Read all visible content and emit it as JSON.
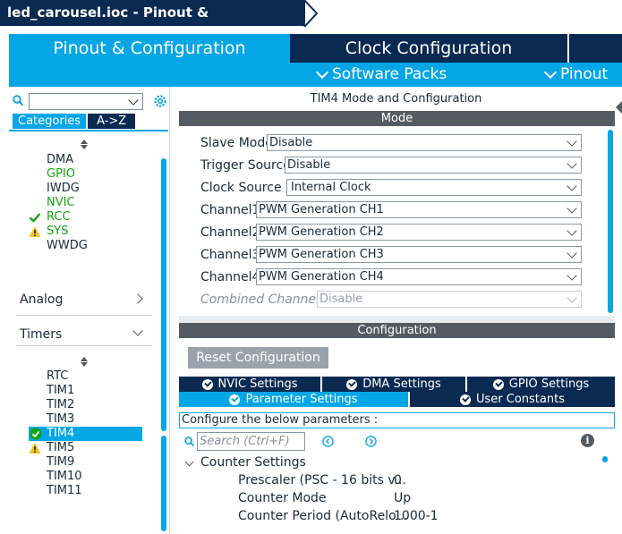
{
  "window": {
    "title": "led_carousel.ioc - Pinout & Configuration"
  },
  "main_tabs": [
    {
      "label": "Pinout & Configuration",
      "active": true
    },
    {
      "label": "Clock Configuration",
      "active": false
    }
  ],
  "sub_menu": {
    "software_packs": "Software Packs",
    "pinout": "Pinout"
  },
  "left": {
    "search": {
      "value": "",
      "placeholder": ""
    },
    "tabs": {
      "categories": "Categories",
      "az": "A->Z"
    },
    "system_core": [
      {
        "label": "DMA",
        "status": "none"
      },
      {
        "label": "GPIO",
        "status": "configured"
      },
      {
        "label": "IWDG",
        "status": "none"
      },
      {
        "label": "NVIC",
        "status": "configured"
      },
      {
        "label": "RCC",
        "status": "ok"
      },
      {
        "label": "SYS",
        "status": "warning"
      },
      {
        "label": "WWDG",
        "status": "none"
      }
    ],
    "sections": {
      "analog": "Analog",
      "timers": "Timers"
    },
    "timers": [
      {
        "label": "RTC",
        "status": "none"
      },
      {
        "label": "TIM1",
        "status": "none"
      },
      {
        "label": "TIM2",
        "status": "none"
      },
      {
        "label": "TIM3",
        "status": "none"
      },
      {
        "label": "TIM4",
        "status": "ok",
        "selected": true
      },
      {
        "label": "TIM5",
        "status": "warning"
      },
      {
        "label": "TIM9",
        "status": "none"
      },
      {
        "label": "TIM10",
        "status": "none"
      },
      {
        "label": "TIM11",
        "status": "none"
      }
    ]
  },
  "right": {
    "title": "TIM4 Mode and Configuration",
    "mode_band": "Mode",
    "mode_rows": [
      {
        "label": "Slave Mode",
        "value": "Disable"
      },
      {
        "label": "Trigger Source",
        "value": "Disable"
      },
      {
        "label": "Clock Source",
        "value": "Internal Clock"
      },
      {
        "label": "Channel1",
        "value": "PWM Generation CH1"
      },
      {
        "label": "Channel2",
        "value": "PWM Generation CH2"
      },
      {
        "label": "Channel3",
        "value": "PWM Generation CH3"
      },
      {
        "label": "Channel4",
        "value": "PWM Generation CH4"
      },
      {
        "label": "Combined Channels",
        "value": "Disable",
        "disabled": true
      }
    ],
    "config_band": "Configuration",
    "reset_button": "Reset Configuration",
    "settings_tabs_row1": [
      "NVIC Settings",
      "DMA Settings",
      "GPIO Settings"
    ],
    "settings_tabs_row2": [
      "Parameter Settings",
      "User Constants"
    ],
    "configure_text": "Configure the below parameters :",
    "param_search_placeholder": "Search (Ctrl+F)",
    "counter_settings": "Counter Settings",
    "params": [
      {
        "name": "Prescaler (PSC - 16 bits v...",
        "value": "0"
      },
      {
        "name": "Counter Mode",
        "value": "Up"
      },
      {
        "name": "Counter Period (AutoRelo...",
        "value": "1000-1"
      }
    ]
  },
  "colors": {
    "navy": "#0a2a52",
    "accent": "#05a6e6",
    "ok": "#12a312",
    "warning": "#f2c318",
    "band": "#555b62"
  }
}
